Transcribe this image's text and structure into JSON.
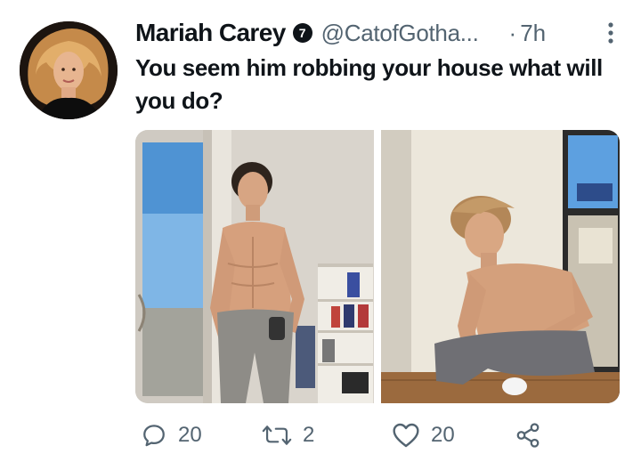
{
  "tweet": {
    "author": {
      "display_name": "Mariah Carey",
      "badge": "7",
      "handle": "@CatofGotha...",
      "avatar_icon": "profile-avatar"
    },
    "time_separator": "·",
    "time": "7h",
    "more_icon": "more-vertical-icon",
    "text": "You seem him robbing your house what will you do?",
    "media": [
      {
        "description": "photo-left",
        "icon": "photo"
      },
      {
        "description": "photo-right",
        "icon": "photo"
      }
    ],
    "actions": {
      "reply": {
        "icon": "reply-icon",
        "count": "20"
      },
      "retweet": {
        "icon": "retweet-icon",
        "count": "2"
      },
      "like": {
        "icon": "heart-icon",
        "count": "20"
      },
      "share": {
        "icon": "share-icon"
      }
    }
  },
  "colors": {
    "text_primary": "#0f1419",
    "text_secondary": "#536471",
    "background": "#ffffff"
  }
}
